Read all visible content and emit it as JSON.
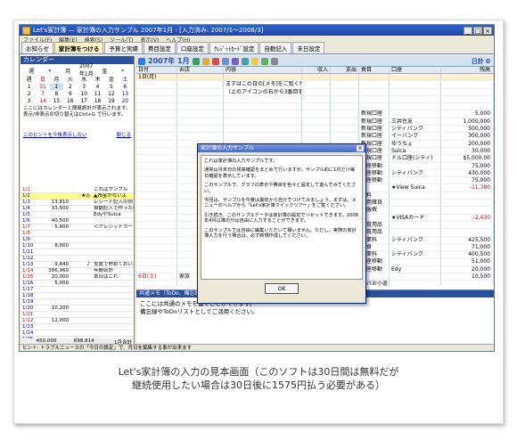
{
  "window": {
    "title": "Let's家計簿 — 家計簿の入力サンプル 2007年1月 - [入力済み: 2007/1〜2008/3]",
    "controls": [
      "_",
      "□",
      "×"
    ]
  },
  "menu": [
    "ファイル(F)",
    "編集(E)",
    "検索(S)",
    "ツール(T)",
    "表示(V)",
    "ヘルプ(H)"
  ],
  "tabs": [
    "お知らせ",
    "家計簿をつける",
    "予算と実績",
    "費目設定",
    "口座設定",
    "ｸﾚｼﾞｯﾄｶｰﾄﾞ設定",
    "自動記入",
    "未日設定"
  ],
  "calendar": {
    "header": "カレンダー",
    "nav": [
      "週",
      "«",
      "月",
      "2007年1月",
      "金",
      "»"
    ],
    "weekdays": [
      "週",
      "日",
      "月",
      "火",
      "水",
      "木",
      "金",
      "土"
    ],
    "weeks": [
      [
        "1",
        "31",
        "1",
        "2",
        "3",
        "4",
        "5",
        "6"
      ],
      [
        "2",
        "7",
        "8",
        "9",
        "10",
        "11",
        "12",
        "13"
      ],
      [
        "3",
        "14",
        "15",
        "16",
        "17",
        "18",
        "19",
        "20"
      ]
    ],
    "info": "ここにはカレンダーと簡易統計が表示されます。表示/非表示の切り替えはCtrl+G で行います。",
    "link": "このヒントを今後表示しない",
    "link_right": "閉じる"
  },
  "left_rows": [
    {
      "d": "1/1",
      "a": "",
      "b": "",
      "m": "これはサンプル"
    },
    {
      "d": "1/2",
      "a": "",
      "b": "★◎",
      "m": "▲残金がないよ"
    },
    {
      "d": "1/3",
      "a": "13,810",
      "b": "",
      "m": "レシート記入の例"
    },
    {
      "d": "1/4",
      "a": "33,500",
      "b": "",
      "m": "自動記入で作った例"
    },
    {
      "d": "1/5",
      "a": "",
      "b": "",
      "m": "EdyやSuica"
    },
    {
      "d": "1/6",
      "a": "40,500",
      "b": "",
      "m": ""
    },
    {
      "d": "1/7",
      "a": "5,600",
      "b": "",
      "m": "＜クレジットカード"
    },
    {
      "d": "1/8",
      "a": "",
      "b": "",
      "m": ""
    },
    {
      "d": "1/9",
      "a": "",
      "b": "",
      "m": ""
    },
    {
      "d": "1/10",
      "a": "8,000",
      "b": "",
      "m": ""
    },
    {
      "d": "1/11",
      "a": "",
      "b": "",
      "m": ""
    },
    {
      "d": "1/12",
      "a": "",
      "b": "",
      "m": ""
    },
    {
      "d": "1/13",
      "a": "9,840",
      "b": "♪",
      "m": "支度で貯めておいた"
    },
    {
      "d": "1/14",
      "a": "386,960",
      "b": "",
      "m": "年間合計"
    },
    {
      "d": "1/15",
      "a": "20,000",
      "b": "",
      "m": "本日はこれ"
    },
    {
      "d": "1/16",
      "a": "5,000",
      "b": "",
      "m": ""
    },
    {
      "d": "1/17",
      "a": "",
      "b": "",
      "m": ""
    },
    {
      "d": "1/18",
      "a": "",
      "b": "",
      "m": ""
    },
    {
      "d": "1/19",
      "a": "",
      "b": "",
      "m": ""
    },
    {
      "d": "1/20",
      "a": "10,200",
      "b": "",
      "m": ""
    },
    {
      "d": "1/21",
      "a": "",
      "b": "",
      "m": ""
    },
    {
      "d": "1/22",
      "a": "12,000",
      "b": "",
      "m": ""
    },
    {
      "d": "1/23",
      "a": "",
      "b": "",
      "m": ""
    },
    {
      "d": "1/24",
      "a": "",
      "b": "",
      "m": ""
    },
    {
      "d": "1/25",
      "a": "",
      "b": "",
      "m": ""
    },
    {
      "d": "1/26",
      "a": "450,000",
      "b": "115,500",
      "m": "給与"
    },
    {
      "d": "1/27",
      "a": "",
      "b": "7,400",
      "m": ""
    },
    {
      "d": "1/28",
      "a": "",
      "b": "6,000",
      "m": ""
    },
    {
      "d": "1/29",
      "a": "",
      "b": "",
      "m": ""
    },
    {
      "d": "1/30",
      "a": "",
      "b": "",
      "m": ""
    },
    {
      "d": "1/31",
      "a": "",
      "b": "121,500",
      "m": "＜分割返済"
    }
  ],
  "left_footer": {
    "total_in": "450,000",
    "total_out": "698,814",
    "label": "1月合計"
  },
  "ledger": {
    "month": "2007年 1月",
    "total_label": "日計 0",
    "columns": [
      "日付",
      "お店",
      "内容",
      "収入",
      "支出",
      "費目",
      "口座",
      "残高"
    ],
    "rows": [
      {
        "c1": "1日(月)",
        "c2": "",
        "c3": "",
        "c4": "",
        "c5": "",
        "c6": "",
        "c7": "",
        "c8": ""
      },
      {
        "c1": "",
        "c2": "",
        "c3": "まずはこの日の[メモ]をご覧ください",
        "c4": "",
        "c5": "",
        "c6": "",
        "c7": "",
        "c8": ""
      },
      {
        "c1": "",
        "c2": "",
        "c3": "（上のアイコンの右から3番目をクリック）",
        "c4": "",
        "c5": "",
        "c6": "",
        "c7": "",
        "c8": ""
      },
      {
        "c1": "",
        "c2": "",
        "c3": "",
        "c4": "",
        "c5": "",
        "c6": "",
        "c7": "",
        "c8": ""
      },
      {
        "c1": "",
        "c2": "",
        "c3": "",
        "c4": "",
        "c5": "",
        "c6": "",
        "c7": "",
        "c8": ""
      },
      {
        "c1": "",
        "c2": "",
        "c3": "",
        "c4": "",
        "c5": "",
        "c6": "新規口座",
        "c7": "",
        "c8": "5,000"
      },
      {
        "c1": "",
        "c2": "",
        "c3": "",
        "c4": "",
        "c5": "",
        "c6": "新規口座",
        "c7": "三井住友",
        "c8": "1,000,000"
      },
      {
        "c1": "",
        "c2": "",
        "c3": "",
        "c4": "",
        "c5": "",
        "c6": "新規口座",
        "c7": "シティバンク",
        "c8": "500,000"
      },
      {
        "c1": "",
        "c2": "",
        "c3": "",
        "c4": "",
        "c5": "",
        "c6": "新規口座",
        "c7": "イーバンク",
        "c8": "300,000"
      },
      {
        "c1": "",
        "c2": "",
        "c3": "",
        "c4": "",
        "c5": "",
        "c6": "新規口座",
        "c7": "ゆうちょ",
        "c8": "200,000"
      },
      {
        "c1": "",
        "c2": "",
        "c3": "",
        "c4": "",
        "c5": "",
        "c6": "新規口座",
        "c7": "Suica",
        "c8": "30,000"
      },
      {
        "c1": "",
        "c2": "",
        "c3": "",
        "c4": "",
        "c5": "",
        "c6": "新規口座",
        "c7": "ドル口座(シティ)",
        "c8": "$5,000.00"
      },
      {
        "c1": "",
        "c2": "",
        "c3": "",
        "c4": "",
        "c5": "",
        "c6": "口座移動",
        "c7": "",
        "c8": "75,000"
      },
      {
        "c1": "",
        "c2": "",
        "c3": "",
        "c4": "",
        "c5": "70,000",
        "c6": "口座移動",
        "c7": "シティバンク",
        "c8": "430,000"
      },
      {
        "c1": "",
        "c2": "",
        "c3": "",
        "c4": "",
        "c5": "",
        "c6": "口座移動",
        "c7": "",
        "c8": "75,000"
      },
      {
        "c1": "",
        "c2": "",
        "c3": "",
        "c4": "",
        "c5": "11,380",
        "c6": "",
        "c7": "★View Suica",
        "c8": "-11,380"
      },
      {
        "c1": "",
        "c2": "",
        "c3": "",
        "c4": "",
        "c5": "7,600",
        "c6": "食料",
        "c7": "",
        "c8": ""
      },
      {
        "c1": "",
        "c2": "",
        "c3": "",
        "c4": "",
        "c5": "1,000",
        "c6": "日用雑貨",
        "c7": "",
        "c8": ""
      },
      {
        "c1": "",
        "c2": "",
        "c3": "",
        "c4": "",
        "c5": "1,980",
        "c6": "被服費",
        "c7": "",
        "c8": ""
      },
      {
        "c1": "",
        "c2": "",
        "c3": "",
        "c4": "",
        "c5": "2,430",
        "c6": "",
        "c7": "★VISAカード",
        "c8": "-2,430"
      },
      {
        "c1": "",
        "c2": "",
        "c3": "",
        "c4": "",
        "c5": "980",
        "c6": "知育用品",
        "c7": "",
        "c8": ""
      },
      {
        "c1": "",
        "c2": "",
        "c3": "",
        "c4": "",
        "c5": "1,450",
        "c6": "知育用品",
        "c7": "",
        "c8": ""
      },
      {
        "c1": "",
        "c2": "",
        "c3": "",
        "c4": "",
        "c5": "4,500",
        "c6": "授業料",
        "c7": "シティバンク",
        "c8": "425,500"
      },
      {
        "c1": "",
        "c2": "",
        "c3": "",
        "c4": "",
        "c5": "4,000",
        "c6": "給食",
        "c7": "",
        "c8": "71,000"
      },
      {
        "c1": "",
        "c2": "",
        "c3": "",
        "c4": "",
        "c5": "25,000",
        "c6": "授業料",
        "c7": "シティバンク",
        "c8": "400,500"
      },
      {
        "c1": "",
        "c2": "",
        "c3": "",
        "c4": "",
        "c5": "20,000",
        "c6": "口座移動",
        "c7": "",
        "c8": "51,000"
      },
      {
        "c1": "",
        "c2": "",
        "c3": "Edyチャージ(入)",
        "c4": "20,000",
        "c5": "",
        "c6": "口座移動",
        "c7": "Edy",
        "c8": "20,000"
      },
      {
        "c1": "6日(土)",
        "c2": "家族",
        "c3": "レシート合計(3件)",
        "c4": "",
        "c5": "40,500",
        "c6": "",
        "c7": "",
        "c8": "10,500"
      },
      {
        "c1": "",
        "c2": "",
        "c3": "パパおこ小遣い(2007年1月分)",
        "c4": "",
        "c5": "30,000",
        "c6": "パパお小遣",
        "c7": "",
        "c8": ""
      }
    ]
  },
  "memo": {
    "header": "共通メモ（ToDo、備忘録などにお使いください）",
    "lines": [
      "ここには共通のメモを書くことができます。",
      "備忘録やToDoリストとしてご活用ください。"
    ]
  },
  "status": "ヒント: トラブルニュースの「今日の設定」で、月日を編集する事が出来ます",
  "dialog": {
    "title": "家計簿の入力サンプル",
    "paragraphs": [
      "これは家計簿の入力サンプルです。",
      "通常は月末日の残高確認をまとめて行いますが、サンプル的に1月だけ毎日確認を表示しています。",
      "このサンプルで、グラフの表示や費目を色々と設定して遊んでみてください。",
      "今回は、サンプルを今度は最初から自分でつけてみましょう。まずは、メニューのヘルプから「Let's家計簿クイックツアー」をご覧ください。",
      "引き続き、このサンプルデータは家計簿の設定でリセットできます。2008年4月以降の分は自由に入力することができます。",
      "このサンプルでは自由に編集いただいて構いません。ただし、実際の家計簿入力を行う場合は、必ず新規作成してください。"
    ],
    "ok": "OK"
  },
  "caption": {
    "line1": "Let's家計簿の入力の見本画面（このソフトは30日間は無料だが",
    "line2": "継続使用したい場合は30日後に1575円払う必要がある）"
  }
}
